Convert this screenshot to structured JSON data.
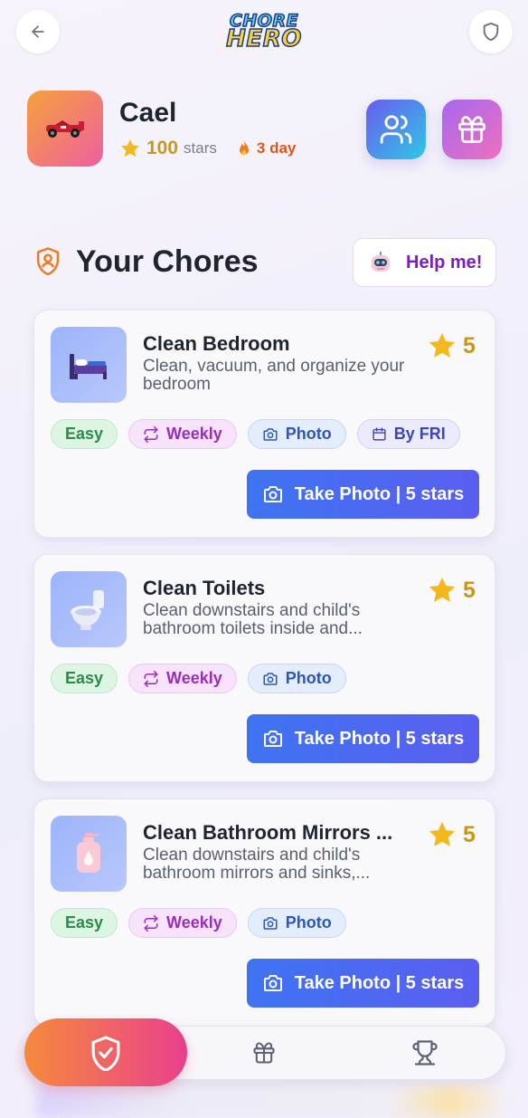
{
  "app": {
    "logo_line1": "CHORE",
    "logo_line2": "HERO"
  },
  "topbar": {
    "back_icon": "arrow-left-icon",
    "right_icon": "shield-icon"
  },
  "profile": {
    "name": "Cael",
    "stars": "100",
    "stars_label": "stars",
    "streak": "3 day",
    "avatar_icon": "race-car-icon"
  },
  "header_buttons": [
    {
      "icon": "users-icon"
    },
    {
      "icon": "gift-icon"
    }
  ],
  "section": {
    "title": "Your Chores",
    "help_label": "Help me!"
  },
  "chores": [
    {
      "title": "Clean Bedroom",
      "description": "Clean, vacuum, and organize your bedroom",
      "reward": "5",
      "icon": "bed-icon",
      "tags": {
        "difficulty": "Easy",
        "frequency": "Weekly",
        "proof": "Photo",
        "due": "By FRI"
      },
      "action": "Take Photo | 5 stars"
    },
    {
      "title": "Clean Toilets",
      "description": "Clean downstairs and child's bathroom toilets inside and...",
      "reward": "5",
      "icon": "toilet-icon",
      "tags": {
        "difficulty": "Easy",
        "frequency": "Weekly",
        "proof": "Photo"
      },
      "action": "Take Photo | 5 stars"
    },
    {
      "title": "Clean Bathroom Mirrors ...",
      "description": "Clean downstairs and child's bathroom mirrors and sinks,...",
      "reward": "5",
      "icon": "soap-bottle-icon",
      "tags": {
        "difficulty": "Easy",
        "frequency": "Weekly",
        "proof": "Photo"
      },
      "action": "Take Photo | 5 stars"
    }
  ],
  "bottom_nav": [
    {
      "icon": "shield-check-icon",
      "active": true
    },
    {
      "icon": "gift-icon",
      "active": false
    },
    {
      "icon": "trophy-icon",
      "active": false
    }
  ],
  "colors": {
    "accent_blue": "#3e74f2",
    "star_gold": "#c9971a",
    "streak_orange": "#e2561b",
    "help_purple": "#7a1ec2"
  }
}
